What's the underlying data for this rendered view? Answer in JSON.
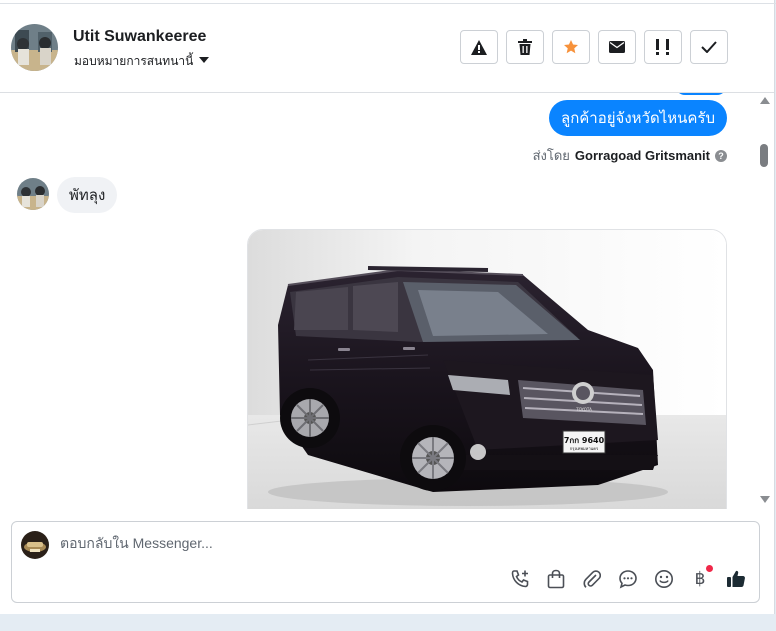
{
  "header": {
    "name": "Utit Suwankeeree",
    "assign_label": "มอบหมายการสนทนานี้",
    "actions": [
      {
        "icon": "warning-icon",
        "color": "#1c1e21"
      },
      {
        "icon": "trash-icon",
        "color": "#1c1e21"
      },
      {
        "icon": "star-icon",
        "color": "#f7923b"
      },
      {
        "icon": "envelope-icon",
        "color": "#1c1e21"
      },
      {
        "icon": "important-icon",
        "color": "#1c1e21"
      },
      {
        "icon": "check-icon",
        "color": "#1c1e21"
      }
    ]
  },
  "thread": {
    "outgoing_text": "ลูกค้าอยู่จังหวัดไหนครับ",
    "sent_by_prefix": "ส่งโดย",
    "sent_by_name": "Gorragoad Gritsmanit",
    "incoming_text": "พัทลุง",
    "photo_plate": "7กก 9640",
    "photo_plate_sub": "กรุงเทพมหานคร",
    "photo_brand": "TOYOTA"
  },
  "composer": {
    "placeholder": "ตอบกลับใน Messenger...",
    "tools": [
      "call-plus-icon",
      "shopping-bag-icon",
      "paperclip-icon",
      "chat-bubble-icon",
      "emoji-icon",
      "baht-icon",
      "thumbs-up-icon"
    ]
  },
  "colors": {
    "accent": "#0a84ff",
    "incoming_bubble": "#f0f2f5",
    "star": "#f7923b",
    "notification": "#f02849"
  }
}
